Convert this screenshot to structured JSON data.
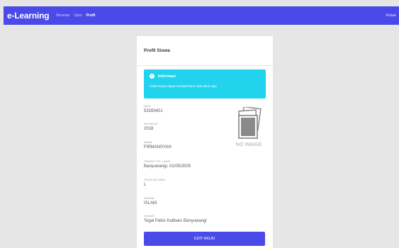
{
  "navbar": {
    "brand": "e-Learning",
    "links": [
      {
        "label": "Beranda",
        "active": false
      },
      {
        "label": "Ujian",
        "active": false
      },
      {
        "label": "Profil",
        "active": true
      }
    ],
    "logout_label": "Keluar"
  },
  "card": {
    "title": "Profil Siswa",
    "alert": {
      "icon": "info-icon",
      "title": "Informasi",
      "body": "Anda hanya dapat memperbarui data akun saja."
    },
    "fields": [
      {
        "label": "NISN",
        "value": "53283401"
      },
      {
        "label": "NO INDUK",
        "value": "2018"
      },
      {
        "label": "NAMA",
        "value": "FIRMANSYAH"
      },
      {
        "label": "TEMPAT TGL LAHIR",
        "value": "Banyuwangi, 01/05/2005"
      },
      {
        "label": "JENIS KELAMIN",
        "value": "L"
      },
      {
        "label": "AGAMA",
        "value": "ISLAM"
      },
      {
        "label": "ALAMAT",
        "value": "Tegal Pakis Kalibaru Banyuwangi"
      }
    ],
    "no_image_label": "NO IMAGE",
    "edit_button_label": "EDIT AKUN"
  },
  "colors": {
    "primary": "#4a4ae8",
    "info": "#22d3ee",
    "background": "#e6e6e6"
  }
}
